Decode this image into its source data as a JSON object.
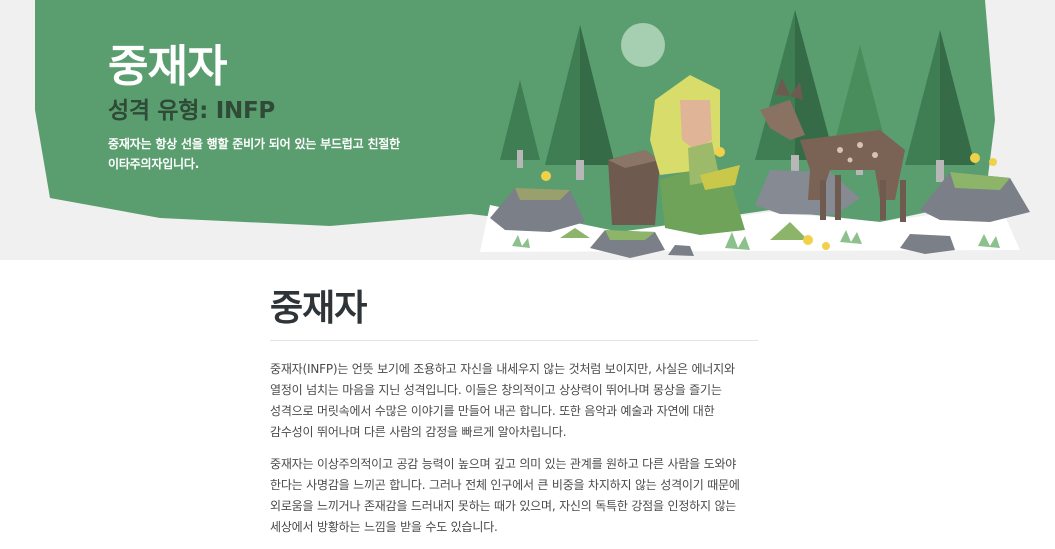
{
  "hero": {
    "title": "중재자",
    "subtitle": "성격 유형: INFP",
    "description": "중재자는 항상 선을 행할 준비가 되어 있는 부드럽고 친절한\n이타주의자입니다.",
    "illustration": "woman-with-deer-forest-illustration",
    "colors": {
      "hero_green": "#5a9e6f",
      "subtitle_dark": "#2f4a37"
    }
  },
  "article": {
    "title": "중재자",
    "paragraphs": [
      "중재자(INFP)는 언뜻 보기에 조용하고 자신을 내세우지 않는 것처럼 보이지만, 사실은 에너지와\n열정이 넘치는 마음을 지닌 성격입니다. 이들은 창의적이고 상상력이 뛰어나며 몽상을 즐기는\n성격으로 머릿속에서 수많은 이야기를 만들어 내곤 합니다. 또한 음악과 예술과 자연에 대한\n감수성이 뛰어나며 다른 사람의 감정을 빠르게 알아차립니다.",
      "중재자는 이상주의적이고 공감 능력이 높으며 깊고 의미 있는 관계를 원하고 다른 사람을 도와야\n한다는 사명감을 느끼곤 합니다. 그러나 전체 인구에서 큰 비중을 차지하지 않는 성격이기 때문에\n외로움을 느끼거나 존재감을 드러내지 못하는 때가 있으며, 자신의 독특한 강점을 인정하지 않는\n세상에서 방황하는 느낌을 받을 수도 있습니다."
    ]
  }
}
